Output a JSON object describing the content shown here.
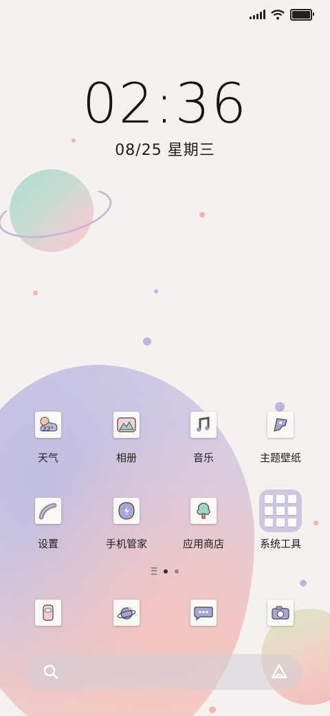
{
  "status_bar": {
    "icons": [
      "signal-icon",
      "wifi-icon",
      "battery-icon"
    ],
    "battery_level": 1.0
  },
  "lock": {
    "time": "02:36",
    "date": "08/25 星期三"
  },
  "apps": {
    "row1": [
      {
        "label": "天气",
        "icon": "weather-icon",
        "temp": "22°"
      },
      {
        "label": "相册",
        "icon": "gallery-icon"
      },
      {
        "label": "音乐",
        "icon": "music-icon"
      },
      {
        "label": "主题壁纸",
        "icon": "theme-icon"
      }
    ],
    "row2": [
      {
        "label": "设置",
        "icon": "settings-icon"
      },
      {
        "label": "手机管家",
        "icon": "security-icon"
      },
      {
        "label": "应用商店",
        "icon": "app-store-icon"
      },
      {
        "label": "系统工具",
        "icon": "system-tools-folder"
      }
    ]
  },
  "dock": [
    {
      "icon": "phone-icon"
    },
    {
      "icon": "browser-icon"
    },
    {
      "icon": "messages-icon"
    },
    {
      "icon": "camera-icon"
    }
  ],
  "pagination": {
    "pages": 2,
    "current": 1
  },
  "search": {
    "icons": [
      "search-icon",
      "assistant-icon"
    ]
  }
}
